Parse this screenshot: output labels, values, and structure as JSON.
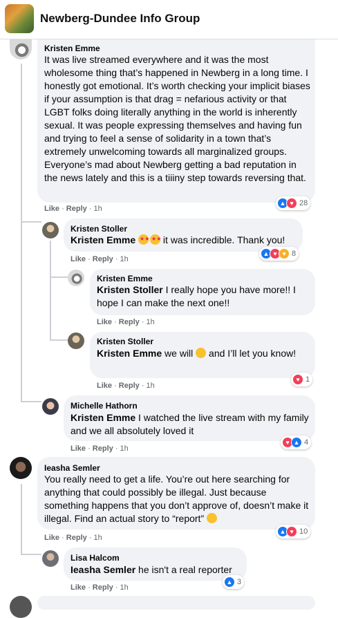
{
  "group": {
    "name": "Newberg-Dundee Info Group"
  },
  "comments": [
    {
      "author": "Kristen Emme",
      "text": "It was live streamed everywhere and it was the most wholesome thing that’s happened in Newberg in a long time. I honestly got emotional. It’s worth checking your implicit biases if your assumption is that drag = nefarious activity or that LGBT folks doing literally anything in the world is inherently sexual. It was people expressing themselves and having fun and trying to feel a sense of solidarity in a town that’s extremely unwelcoming towards all marginalized groups. Everyone’s mad about Newberg getting a bad reputation in the news lately and this is a tiiiny step towards reversing that.",
      "like": "Like",
      "reply": "Reply",
      "time": "1h",
      "reactions": "28"
    },
    {
      "author": "Kristen Stoller",
      "mention": "Kristen Emme",
      "text": " it was incredible. Thank you!",
      "like": "Like",
      "reply": "Reply",
      "time": "1h",
      "reactions": "8"
    },
    {
      "author": "Kristen Emme",
      "mention": "Kristen Stoller",
      "text": " I really hope you have more!! I hope I can make the next one!!",
      "like": "Like",
      "reply": "Reply",
      "time": "1h"
    },
    {
      "author": "Kristen Stoller",
      "mention": "Kristen Emme",
      "text_a": " we will ",
      "text_b": " and I’ll let you know!",
      "like": "Like",
      "reply": "Reply",
      "time": "1h",
      "reactions": "1"
    },
    {
      "author": "Michelle Hathorn",
      "mention": "Kristen Emme",
      "text": " I watched the live stream with my family and we all absolutely loved it",
      "like": "Like",
      "reply": "Reply",
      "time": "1h",
      "reactions": "4"
    },
    {
      "author": "Ieasha Semler",
      "text": "You really need to get a life. You’re out here searching for anything that could possibly be illegal. Just because something happens that you don’t approve of, doesn’t make it illegal. Find an actual story to “report” ",
      "like": "Like",
      "reply": "Reply",
      "time": "1h",
      "reactions": "10"
    },
    {
      "author": "Lisa Halcom",
      "mention": "Ieasha Semler",
      "text": " he isn't a real reporter",
      "like": "Like",
      "reply": "Reply",
      "time": "1h",
      "reactions": "3"
    }
  ],
  "colors": {
    "like": "#1877f2",
    "love": "#f33e58",
    "bubble": "#f0f2f5",
    "meta": "#65676b"
  }
}
